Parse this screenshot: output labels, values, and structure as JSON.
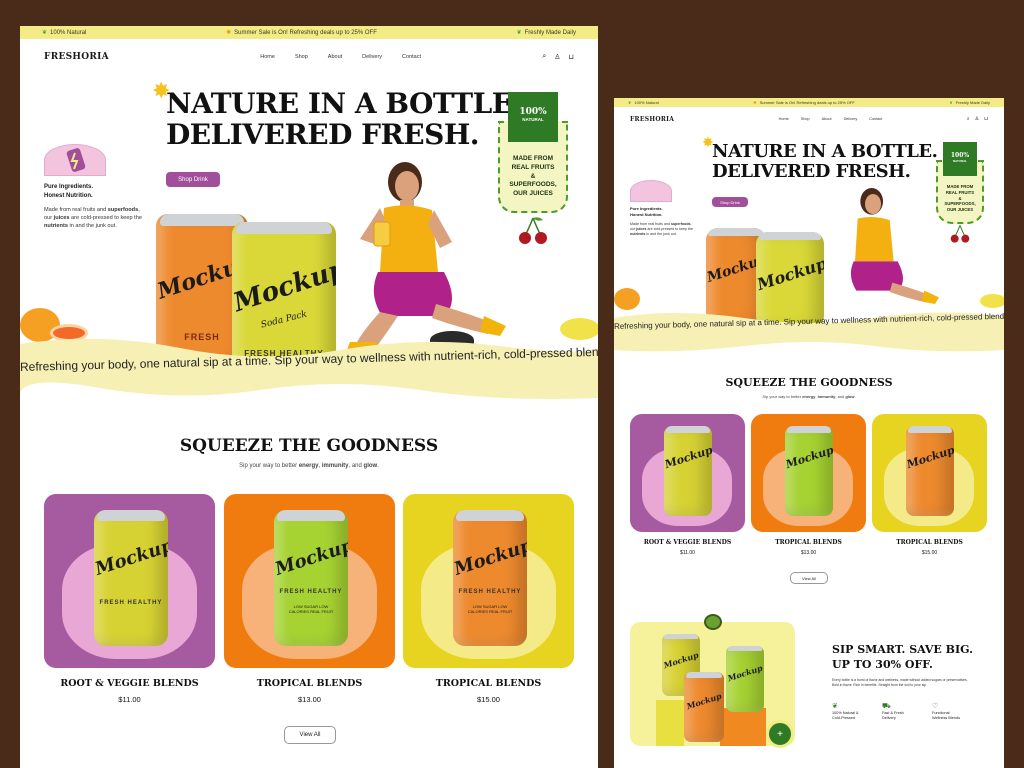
{
  "topbar": {
    "left": "100% Natural",
    "center": "Summer Sale is On! Refreshing deals up to 25% OFF",
    "right": "Freshly Made Daily"
  },
  "nav": {
    "logo": "FRESHORIA",
    "links": [
      "Home",
      "Shop",
      "About",
      "Delivery",
      "Contact"
    ]
  },
  "hero": {
    "title_line1": "NATURE IN A BOTTLE.",
    "title_line2": "DELIVERED FRESH.",
    "pure_line1": "Pure Ingredients.",
    "pure_line2": "Honest Nutrition.",
    "desc_1": "Made from real fruits and",
    "desc_2": "superfoods",
    "desc_3": ", our ",
    "desc_4": "juices",
    "desc_5": " are cold-pressed to keep the ",
    "desc_6": "nutrients",
    "desc_7": " in and the junk out.",
    "cta": "Shop Drink",
    "badge_pct": "100%",
    "badge_word": "NATURAL",
    "badge_text_1": "MADE FROM",
    "badge_text_2": "REAL FRUITS",
    "badge_text_3": "&",
    "badge_text_4": "SUPERFOODS,",
    "badge_text_5": "OUR JUICES",
    "can_brand": "Mockup",
    "can_sub": "Soda Pack",
    "can_fresh": "FRESH HEALTHY",
    "can_fresh_a": "FRESH",
    "can_fresh_b": "HEAL"
  },
  "marquee": "Refreshing your body, one natural sip at a time. Sip your way to wellness with nutrient-rich, cold-pressed blends.",
  "section": {
    "title": "SQUEEZE THE GOODNESS",
    "sub_a": "Sip your way to better ",
    "sub_b": "energy",
    "sub_c": ", ",
    "sub_d": "immunity",
    "sub_e": ", and ",
    "sub_f": "glow",
    "sub_g": ".",
    "view_all": "View All"
  },
  "products": [
    {
      "name": "ROOT & VEGGIE BLENDS",
      "price": "$11.00",
      "bg": "#a65aa0",
      "blob": "#e9a7d6",
      "can": "#d7d234"
    },
    {
      "name": "TROPICAL BLENDS",
      "price": "$13.00",
      "bg": "#f07c10",
      "blob": "#f7b27a",
      "can": "#a6d232"
    },
    {
      "name": "TROPICAL BLENDS",
      "price": "$15.00",
      "bg": "#e6d421",
      "blob": "#f4ea88",
      "can": "#ee8a2e"
    }
  ],
  "can_label_small": "FRESH HEALTHY",
  "can_label_tiny": "LOW SUGAR LOW CALORIES REAL FRUIT",
  "promo": {
    "title_1": "SIP SMART. SAVE BIG.",
    "title_2": "UP TO 30% OFF.",
    "desc_1": "Every bottle is a burst of flavor and wellness, made without added sugars or preservatives.",
    "desc_2": "Bold in flavor. Rich in benefits. Straight from the soil to your sip.",
    "features": [
      {
        "line1": "100% Natural &",
        "line2": "Cold-Pressed"
      },
      {
        "line1": "Fast & Fresh",
        "line2": "Delivery"
      },
      {
        "line1": "Functional",
        "line2": "Wellness Blends"
      }
    ]
  },
  "colors": {
    "topbar": "#f3ec86",
    "accent_purple": "#a14e9b",
    "seal_green": "#2f7a25",
    "page_bg": "#4a2a18"
  }
}
